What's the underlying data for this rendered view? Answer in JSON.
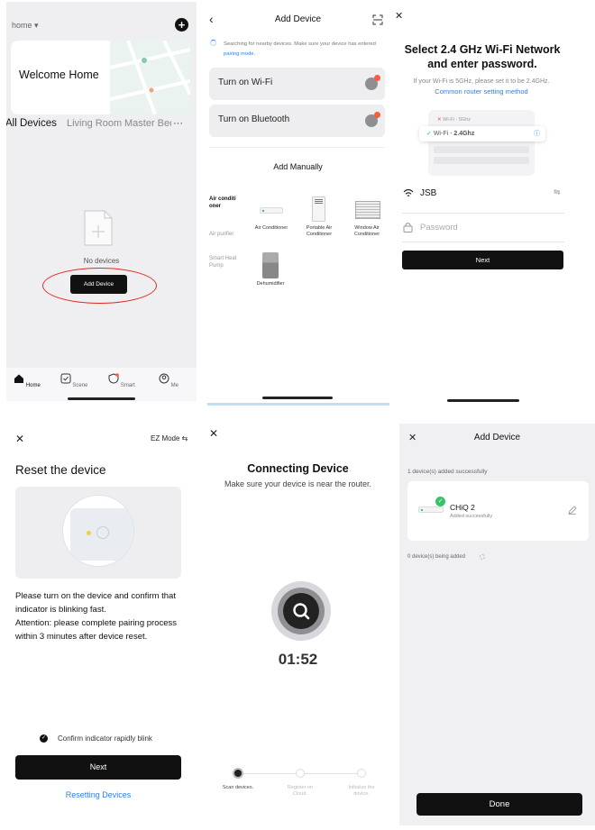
{
  "panel1": {
    "home_selector": "home ▾",
    "welcome": "Welcome Home",
    "rooms": [
      "All Devices",
      "Living Room",
      "Master Bed"
    ],
    "more": "···",
    "empty_text": "No devices",
    "add_device_label": "Add Device",
    "nav": [
      "Home",
      "Scene",
      "Smart",
      "Me"
    ]
  },
  "panel2": {
    "title": "Add Device",
    "searching_text": "Searching for nearby devices. Make sure your device has entered",
    "pairing_link": "pairing mode.",
    "wifi_label": "Turn on Wi-Fi",
    "bluetooth_label": "Turn on Bluetooth",
    "add_manually": "Add Manually",
    "categories": [
      "Air conditi oner",
      "Air purifier",
      "Smart Heat Pump"
    ],
    "devices": [
      "Air Conditioner",
      "Portable Air Conditioner",
      "Window Air Conditioner",
      "Dehumidifier"
    ]
  },
  "panel3": {
    "close": "✕",
    "title": "Select 2.4 GHz Wi-Fi Network and enter password.",
    "subtitle": "If your Wi-Fi is 5GHz, please set it to be 2.4GHz.",
    "router_link": "Common router setting method",
    "wifi_5g": "Wi-Fi - 5Ghz",
    "wifi_24_prefix": "Wi-Fi - ",
    "wifi_24_bold": "2.4Ghz",
    "ssid": "JSB",
    "password_placeholder": "Password",
    "next": "Next"
  },
  "panel4": {
    "close": "✕",
    "mode": "EZ Mode ⇆",
    "title": "Reset the device",
    "instructions": "Please turn on the device and confirm that indicator is blinking fast.",
    "attention": "Attention: please complete pairing process within 3 minutes after device reset.",
    "confirm_label": "Confirm indicator rapidly blink",
    "next": "Next",
    "resetting_link": "Resetting Devices"
  },
  "panel5": {
    "close": "✕",
    "title": "Connecting Device",
    "subtitle": "Make sure your device is near the router.",
    "timer": "01:52",
    "steps": [
      "Scan devices.",
      "Register on Cloud.",
      "Initialize the device."
    ]
  },
  "panel6": {
    "close": "✕",
    "title": "Add Device",
    "added_count": "1 device(s) added successfully",
    "device_name": "CHiQ 2",
    "device_status": "Added successfully",
    "adding_count": "0 device(s) being added",
    "done": "Done"
  },
  "colors": {
    "accent_blue": "#2f7ee8",
    "dark_button": "#111111",
    "success_green": "#35c46a",
    "annotation_red": "#e02a1e"
  }
}
